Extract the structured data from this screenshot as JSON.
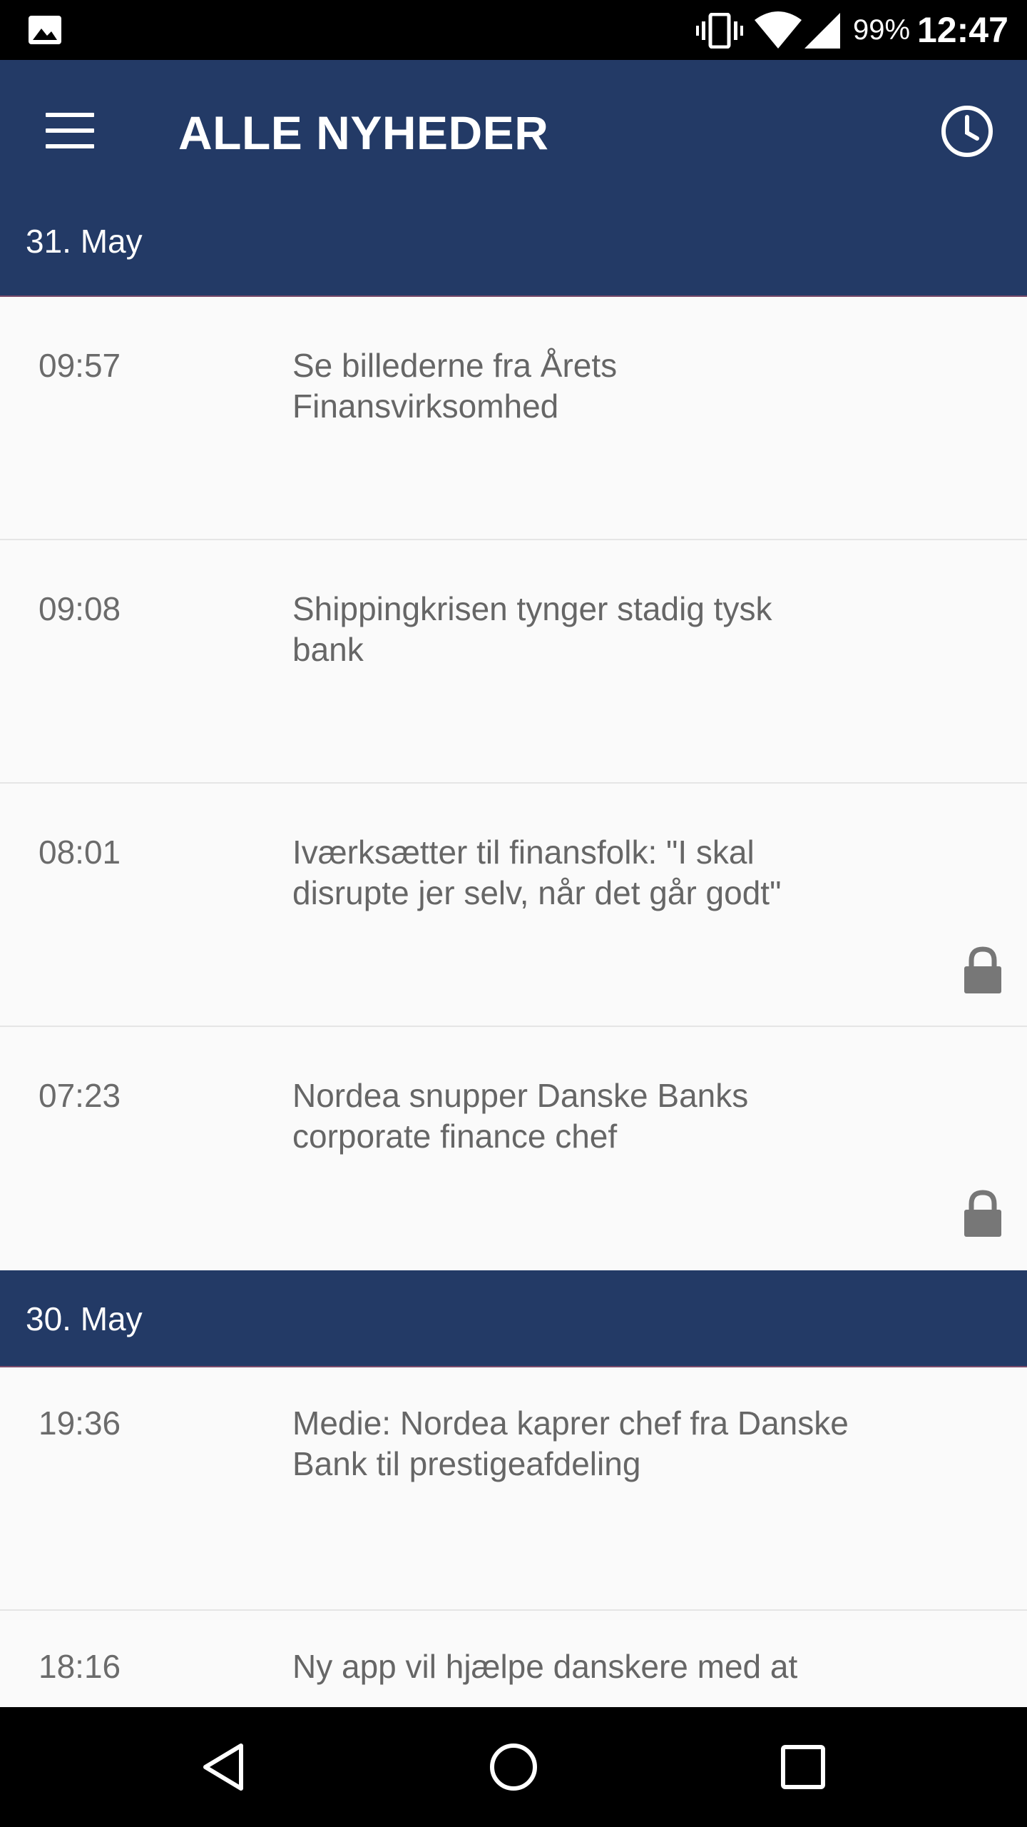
{
  "status_bar": {
    "battery": "99%",
    "time": "12:47",
    "icons": [
      "gallery-icon",
      "vibrate-icon",
      "wifi-icon",
      "signal-icon"
    ]
  },
  "app_bar": {
    "title": "ALLE NYHEDER",
    "menu_icon": "hamburger-menu-icon",
    "history_icon": "clock-icon"
  },
  "sections": [
    {
      "date": "31. May",
      "items": [
        {
          "time": "09:57",
          "headline": "Se billederne fra Årets Finansvirksomhed",
          "locked": false
        },
        {
          "time": "09:08",
          "headline": "Shippingkrisen tynger stadig tysk bank",
          "locked": false
        },
        {
          "time": "08:01",
          "headline": "Iværksætter til finansfolk: \"I skal disrupte jer selv, når det går godt\"",
          "locked": true
        },
        {
          "time": "07:23",
          "headline": "Nordea snupper Danske Banks corporate finance chef",
          "locked": true
        }
      ]
    },
    {
      "date": "30. May",
      "items": [
        {
          "time": "19:36",
          "headline": "Medie: Nordea kaprer chef fra Danske Bank til prestigeafdeling",
          "locked": false
        },
        {
          "time": "18:16",
          "headline": "Ny app vil hjælpe danskere med at",
          "locked": false
        }
      ]
    }
  ],
  "colors": {
    "app_bar": "#233a66",
    "background": "#fafafa",
    "text": "#666666"
  },
  "nav_bar": {
    "icons": [
      "back-icon",
      "home-icon",
      "recents-icon"
    ]
  }
}
